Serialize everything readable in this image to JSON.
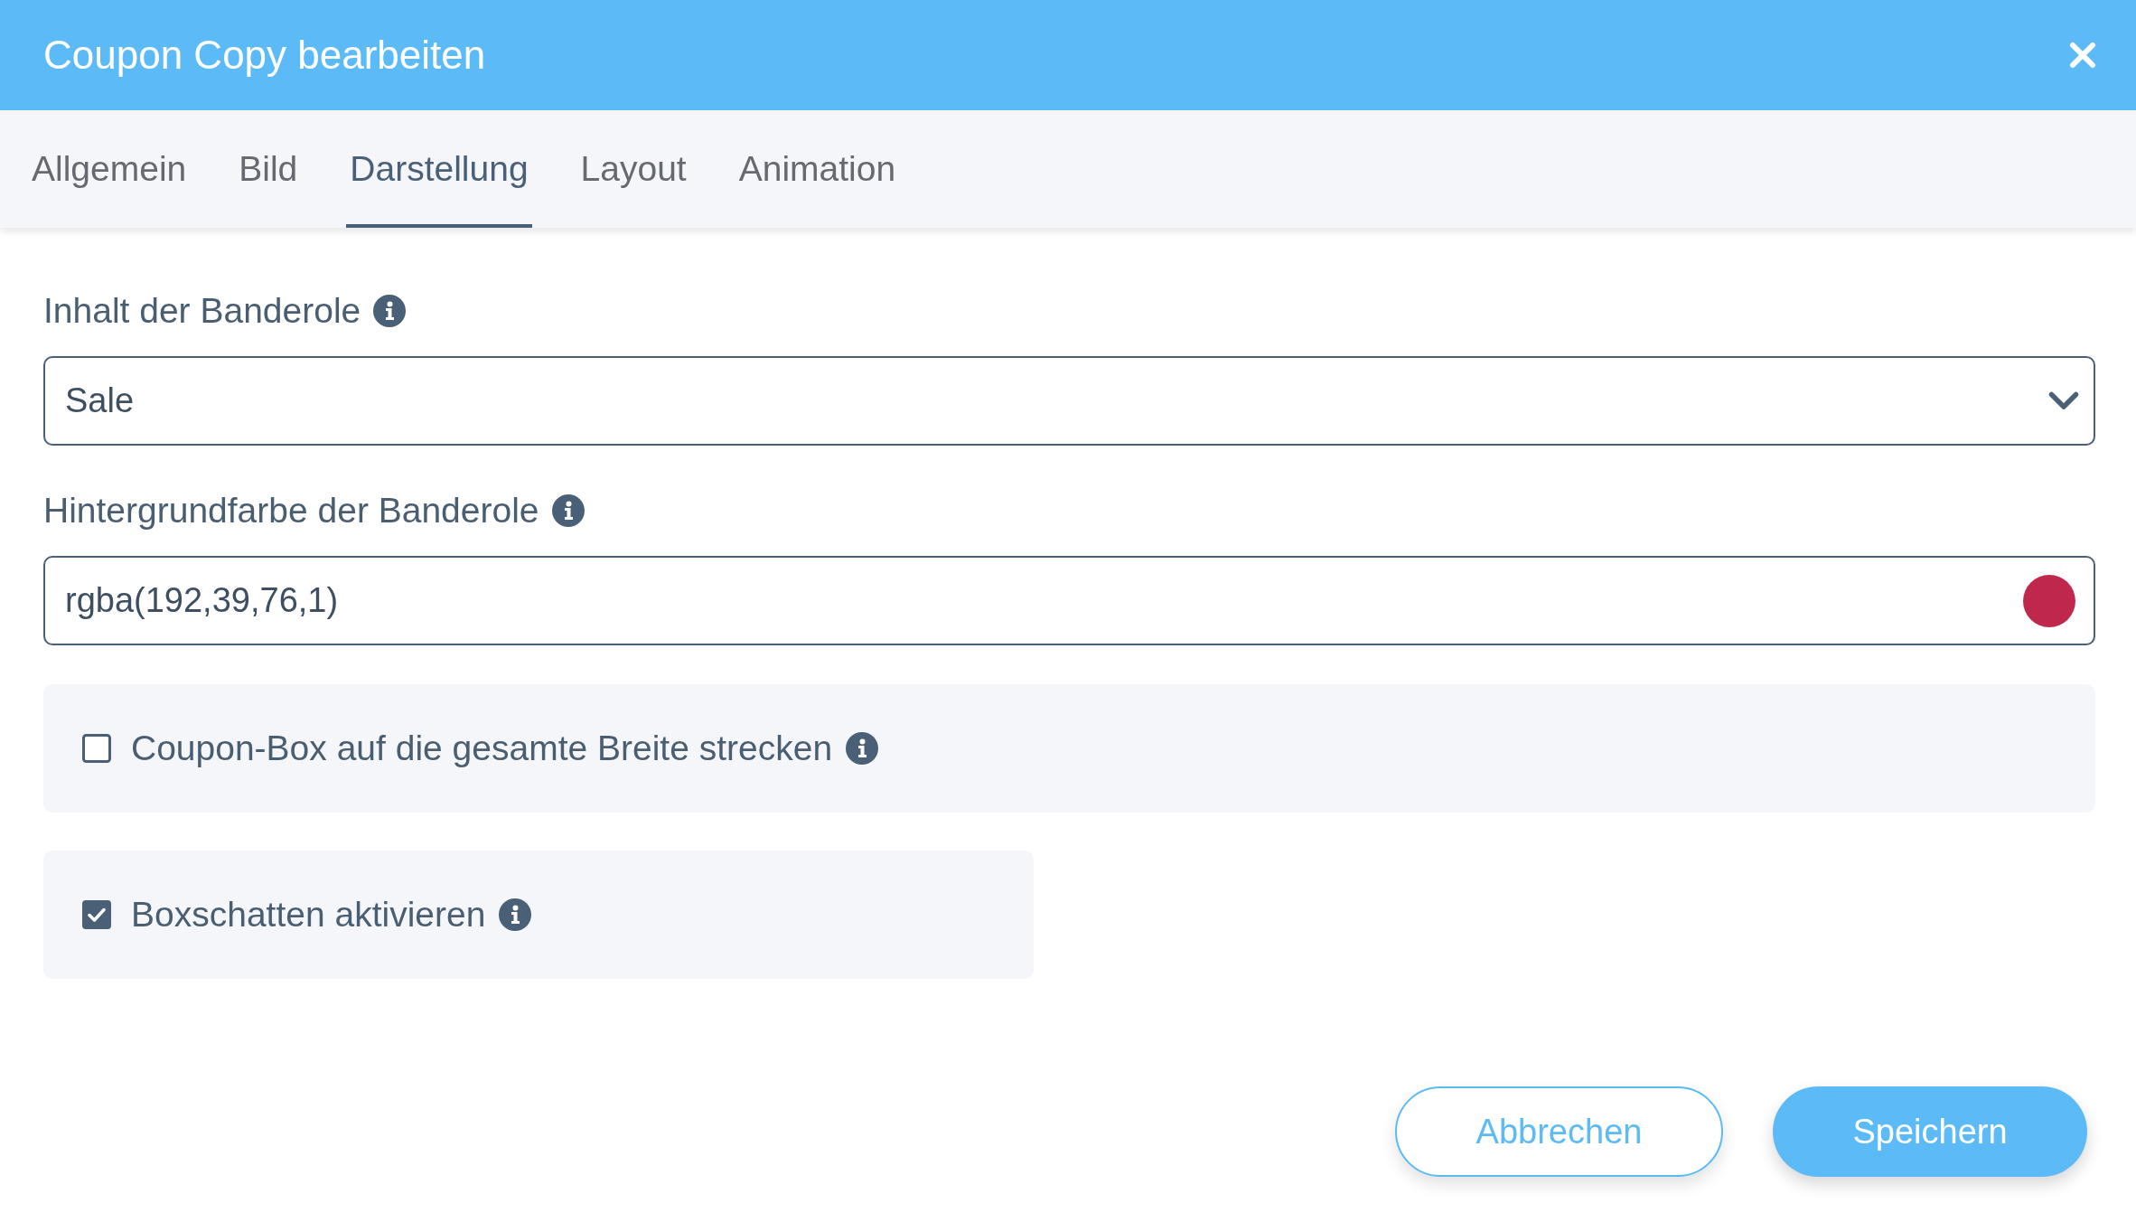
{
  "dialog": {
    "title": "Coupon Copy bearbeiten"
  },
  "tabs": [
    {
      "label": "Allgemein",
      "selected": false
    },
    {
      "label": "Bild",
      "selected": false
    },
    {
      "label": "Darstellung",
      "selected": true
    },
    {
      "label": "Layout",
      "selected": false
    },
    {
      "label": "Animation",
      "selected": false
    }
  ],
  "fields": [
    {
      "kind": "select",
      "label": "Inhalt der Banderole",
      "value": "Sale"
    },
    {
      "kind": "color",
      "label": "Hintergrundfarbe der Banderole",
      "value": "rgba(192,39,76,1)",
      "color": "#c0274c"
    }
  ],
  "options": [
    {
      "label": "Coupon-Box auf die gesamte Breite strecken",
      "checked": false
    },
    {
      "label": "Boxschatten aktivieren",
      "checked": true
    }
  ],
  "buttons": [
    {
      "label": "Abbrechen",
      "kind": "secondary"
    },
    {
      "label": "Speichern",
      "kind": "primary"
    }
  ]
}
